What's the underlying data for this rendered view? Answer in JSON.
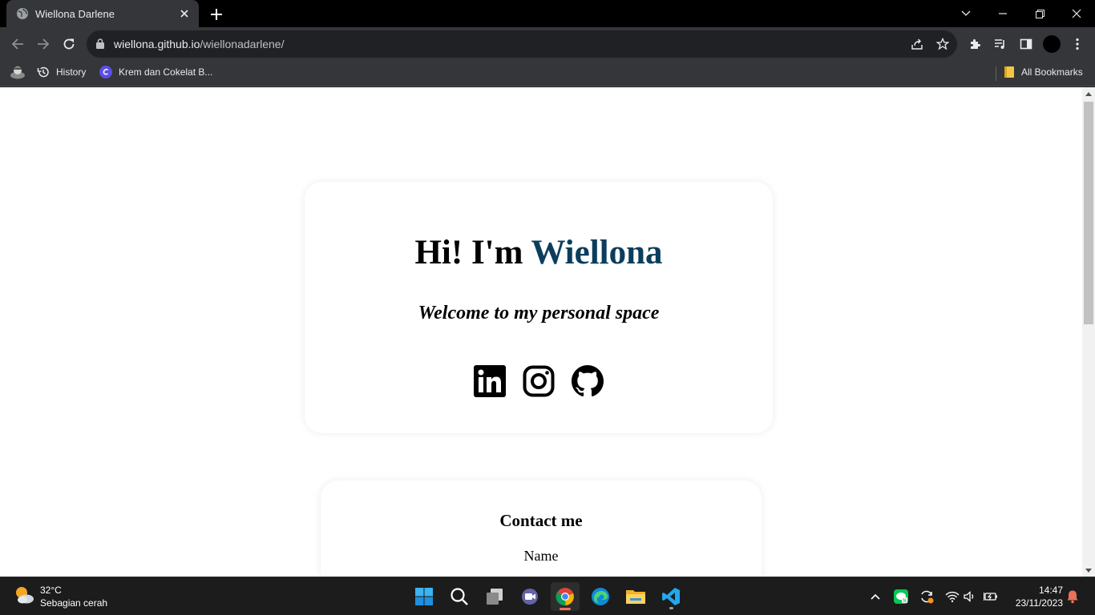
{
  "browser": {
    "tab_title": "Wiellona Darlene",
    "url_host": "wiellona.github.io",
    "url_path": "/wiellonadarlene/",
    "bookmarks": [
      {
        "label": "History",
        "icon": "history-icon"
      },
      {
        "label": "Krem dan Cokelat B...",
        "icon": "canva-icon"
      }
    ],
    "all_bookmarks_label": "All Bookmarks"
  },
  "page": {
    "hero": {
      "greeting": "Hi! I'm",
      "name": "Wiellona",
      "subtitle": "Welcome to my personal space",
      "socials": [
        {
          "name": "LinkedIn",
          "icon": "linkedin-icon"
        },
        {
          "name": "Instagram",
          "icon": "instagram-icon"
        },
        {
          "name": "GitHub",
          "icon": "github-icon"
        }
      ]
    },
    "contact": {
      "title": "Contact me",
      "name_label": "Name"
    },
    "colors": {
      "accent": "#0b3d5c"
    }
  },
  "taskbar": {
    "weather_temp": "32°C",
    "weather_desc": "Sebagian cerah",
    "time": "14:47",
    "date": "23/11/2023",
    "apps": [
      "start-icon",
      "search-icon",
      "task-view-icon",
      "teams-icon",
      "chrome-icon",
      "edge-icon",
      "file-explorer-icon",
      "vscode-icon"
    ]
  }
}
